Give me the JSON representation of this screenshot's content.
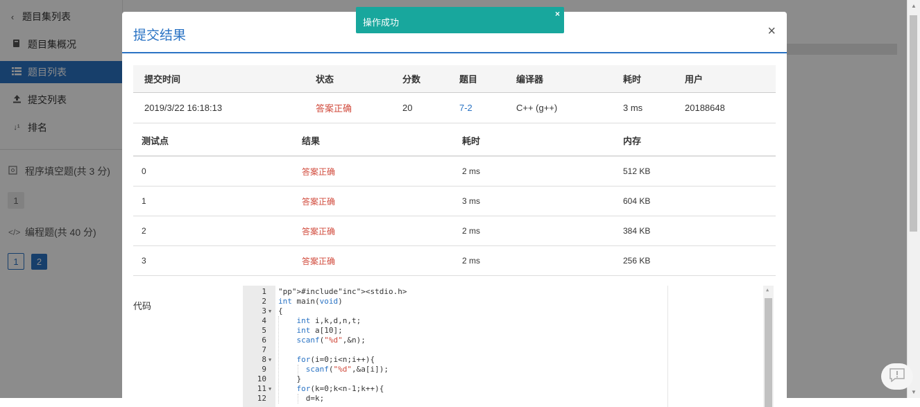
{
  "sidebar": {
    "back_label": "题目集列表",
    "items": [
      {
        "label": "题目集概况",
        "icon": "book-icon"
      },
      {
        "label": "题目列表",
        "icon": "list-icon",
        "active": true
      },
      {
        "label": "提交列表",
        "icon": "upload-icon"
      },
      {
        "label": "排名",
        "icon": "sort-numeric-icon"
      }
    ],
    "groups": [
      {
        "label": "程序填空题(共 3 分)",
        "icon": "blank-fill-icon",
        "problems": [
          "1"
        ]
      },
      {
        "label": "编程题(共 40 分)",
        "icon": "code-icon",
        "problems": [
          "1",
          "2"
        ]
      }
    ]
  },
  "modal": {
    "title": "提交结果",
    "close_label": "×",
    "summary": {
      "headers": [
        "提交时间",
        "状态",
        "分数",
        "题目",
        "编译器",
        "耗时",
        "用户"
      ],
      "row": {
        "time": "2019/3/22 16:18:13",
        "status": "答案正确",
        "score": "20",
        "problem": "7-2",
        "compiler": "C++ (g++)",
        "elapsed": "3 ms",
        "user": "20188648"
      }
    },
    "tests": {
      "headers": [
        "测试点",
        "结果",
        "耗时",
        "内存"
      ],
      "rows": [
        {
          "id": "0",
          "result": "答案正确",
          "time": "2 ms",
          "memory": "512 KB"
        },
        {
          "id": "1",
          "result": "答案正确",
          "time": "3 ms",
          "memory": "604 KB"
        },
        {
          "id": "2",
          "result": "答案正确",
          "time": "2 ms",
          "memory": "384 KB"
        },
        {
          "id": "3",
          "result": "答案正确",
          "time": "2 ms",
          "memory": "256 KB"
        }
      ]
    },
    "code_label": "代码",
    "code_lines": [
      "#include<stdio.h>",
      "int main(void)",
      "{",
      "    int i,k,d,n,t;",
      "    int a[10];",
      "    scanf(\"%d\",&n);",
      "",
      "    for(i=0;i<n;i++){",
      "      scanf(\"%d\",&a[i]);",
      "    }",
      "    for(k=0;k<n-1;k++){",
      "      d=k;"
    ],
    "line_numbers": [
      "1",
      "2",
      "3",
      "4",
      "5",
      "6",
      "7",
      "8",
      "9",
      "10",
      "11",
      "12"
    ]
  },
  "toast": {
    "message": "操作成功",
    "close_label": "×",
    "color": "#18a79d"
  },
  "colors": {
    "accent": "#2a73c4",
    "status_ok": "#d14b3d"
  }
}
